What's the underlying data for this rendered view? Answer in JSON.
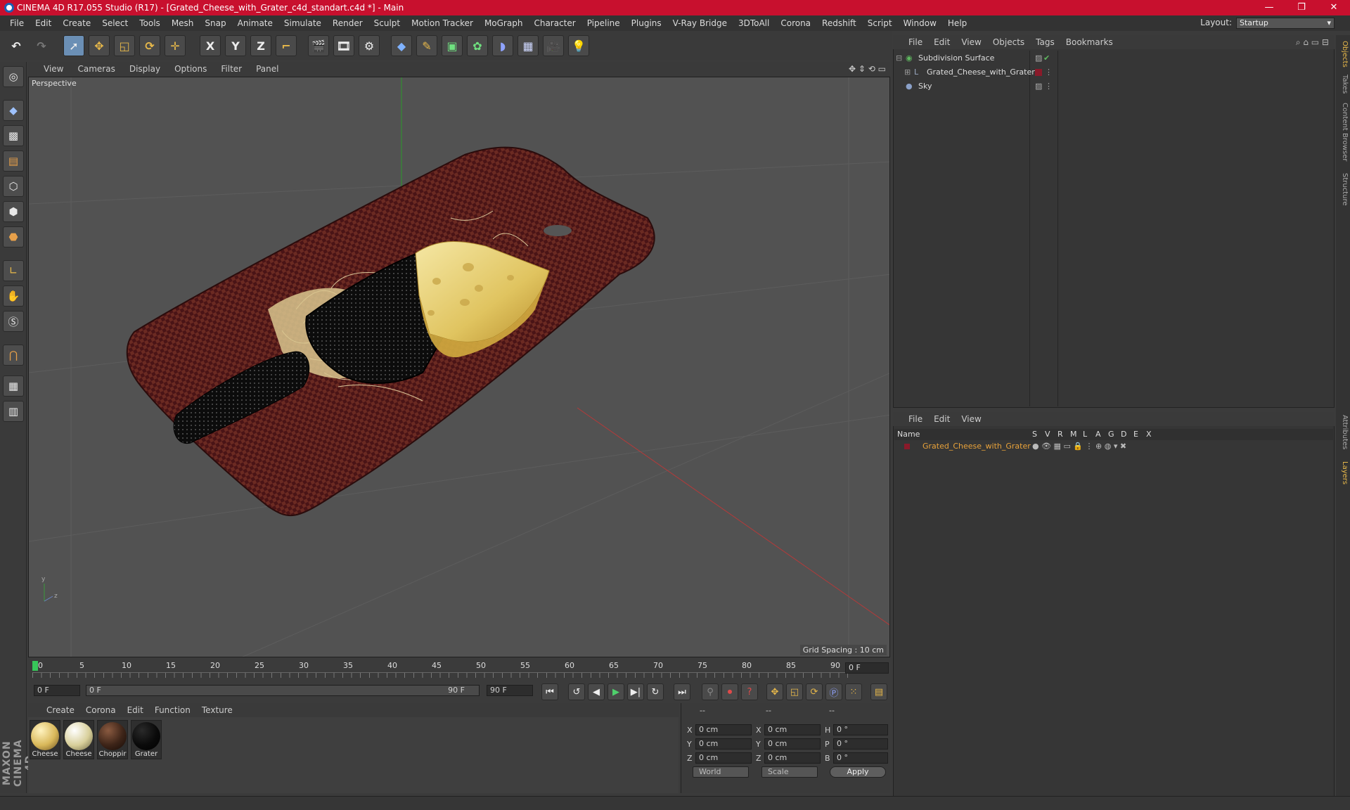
{
  "window": {
    "title": "CINEMA 4D R17.055 Studio (R17) - [Grated_Cheese_with_Grater_c4d_standart.c4d *] - Main",
    "controls": [
      "—",
      "❐",
      "✕"
    ]
  },
  "menubar": [
    "File",
    "Edit",
    "Create",
    "Select",
    "Tools",
    "Mesh",
    "Snap",
    "Animate",
    "Simulate",
    "Render",
    "Sculpt",
    "Motion Tracker",
    "MoGraph",
    "Character",
    "Pipeline",
    "Plugins",
    "V-Ray Bridge",
    "3DToAll",
    "Corona",
    "Redshift",
    "Script",
    "Window",
    "Help"
  ],
  "layout": {
    "label": "Layout:",
    "value": "Startup"
  },
  "toolbar": {
    "x_label": "X",
    "y_label": "Y",
    "z_label": "Z"
  },
  "viewport": {
    "menu": [
      "View",
      "Cameras",
      "Display",
      "Options",
      "Filter",
      "Panel"
    ],
    "camera_label": "Perspective",
    "grid_spacing": "Grid Spacing : 10 cm"
  },
  "timeline": {
    "ticks": [
      "0",
      "5",
      "10",
      "15",
      "20",
      "25",
      "30",
      "35",
      "40",
      "45",
      "50",
      "55",
      "60",
      "65",
      "70",
      "75",
      "80",
      "85",
      "90"
    ],
    "current_frame": "0 F",
    "start_field": "0 F",
    "range_start": "0 F",
    "range_end": "90 F",
    "end_field": "90 F"
  },
  "materials": {
    "menu": [
      "Create",
      "Corona",
      "Edit",
      "Function",
      "Texture"
    ],
    "items": [
      {
        "label": "Cheese",
        "color": "#d9b85a"
      },
      {
        "label": "Cheese",
        "color": "#d8cf9a"
      },
      {
        "label": "Choppir",
        "color": "#3d2418"
      },
      {
        "label": "Grater",
        "color": "#0a0a0a"
      }
    ]
  },
  "coordinates": {
    "header": [
      "--",
      "--",
      "--"
    ],
    "rows": [
      {
        "a": "X",
        "av": "0 cm",
        "b": "X",
        "bv": "0 cm",
        "c": "H",
        "cv": "0 °"
      },
      {
        "a": "Y",
        "av": "0 cm",
        "b": "Y",
        "bv": "0 cm",
        "c": "P",
        "cv": "0 °"
      },
      {
        "a": "Z",
        "av": "0 cm",
        "b": "Z",
        "bv": "0 cm",
        "c": "B",
        "cv": "0 °"
      }
    ],
    "mode": "World",
    "scale": "Scale",
    "apply": "Apply"
  },
  "objects": {
    "menu": [
      "File",
      "Edit",
      "View",
      "Objects",
      "Tags",
      "Bookmarks"
    ],
    "items": [
      {
        "name": "Subdivision Surface",
        "color": "#5fb85f"
      },
      {
        "name": "Grated_Cheese_with_Grater",
        "color": "#9aa8c0"
      },
      {
        "name": "Sky",
        "color": "#8aa0c8"
      }
    ]
  },
  "layers": {
    "menu": [
      "File",
      "Edit",
      "View"
    ],
    "columns": [
      "Name",
      "S",
      "V",
      "R",
      "M",
      "L",
      "A",
      "G",
      "D",
      "E",
      "X"
    ],
    "row_name": "Grated_Cheese_with_Grater",
    "row_color": "#e8a23a"
  },
  "sidetabs": [
    "Objects",
    "Takes",
    "Content Browser",
    "Structure",
    "Attributes",
    "Layers"
  ],
  "logo": "MAXON CINEMA 4D"
}
